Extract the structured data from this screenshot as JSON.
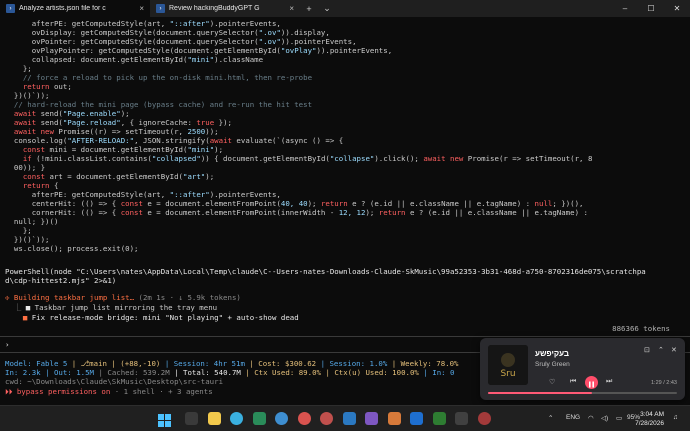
{
  "titlebar": {
    "tab1_title": "Analyze artists.json file for c",
    "tab2_title": "Review hackingBuddyGPT G",
    "close_glyph": "×",
    "add_glyph": "+",
    "dropdown_glyph": "⌄",
    "minimize_glyph": "–",
    "maximize_glyph": "☐",
    "window_close_glyph": "✕"
  },
  "code": {
    "l1a": "afterPE: getComputedStyle(art, ",
    "l1b": "\"::after\"",
    "l1c": ").pointerEvents,",
    "l2a": "ovDisplay: getComputedStyle(document.querySelector(",
    "l2b": "\".ov\"",
    "l2c": ")).display,",
    "l3a": "ovPointer: getComputedStyle(document.querySelector(",
    "l3b": "\".ov\"",
    "l3c": ")).pointerEvents,",
    "l4a": "ovPlayPointer: getComputedStyle(document.getElementById(",
    "l4b": "\"ovPlay\"",
    "l4c": ")).pointerEvents,",
    "l5a": "collapsed: document.getElementById(",
    "l5b": "\"mini\"",
    "l5c": ").className",
    "l6": "};",
    "l7": "// force a reload to pick up the on-disk mini.html, then re-probe",
    "l8a": "return",
    "l8b": " out;",
    "l9": "})()`));",
    "l10": "// hard-reload the mini page (bypass cache) and re-run the hit test",
    "l11a": "await",
    "l11b": " send(",
    "l11c": "\"Page.enable\"",
    "l11d": ");",
    "l12a": "await",
    "l12b": " send(",
    "l12c": "\"Page.reload\"",
    "l12d": ", { ignoreCache: ",
    "l12e": "true",
    "l12f": " });",
    "l13a": "await new",
    "l13b": " Promise((r) => setTimeout(r, ",
    "l13c": "2500",
    "l13d": "));",
    "l14a": "console.log(",
    "l14b": "\"AFTER-RELOAD:\"",
    "l14c": ", JSON.stringify(",
    "l14d": "await",
    "l14e": " evaluate(`(async () => {",
    "l15a": "const",
    "l15b": " mini = document.getElementById(",
    "l15c": "\"mini\"",
    "l15d": ");",
    "l16a": "if",
    "l16b": " (!mini.classList.contains(",
    "l16c": "\"collapsed\"",
    "l16d": ")) { document.getElementById(",
    "l16e": "\"collapse\"",
    "l16f": ").click(); ",
    "l16g": "await new",
    "l16h": " Promise(r => setTimeout(r, 8",
    "l17": "00)); }",
    "l18a": "const",
    "l18b": " art = document.getElementById(",
    "l18c": "\"art\"",
    "l18d": ");",
    "l19a": "return",
    "l19b": " {",
    "l20a": "afterPE: getComputedStyle(art, ",
    "l20b": "\"::after\"",
    "l20c": ").pointerEvents,",
    "l21a": "centerHit: (() => { ",
    "l21b": "const",
    "l21c": " e = document.elementFromPoint(",
    "l21d": "40, 40",
    "l21e": "); ",
    "l21f": "return",
    "l21g": " e ? (e.id || e.className || e.tagName) : ",
    "l21h": "null",
    "l21i": "; })(),",
    "l22a": "cornerHit: (() => { ",
    "l22b": "const",
    "l22c": " e = document.elementFromPoint(innerWidth - ",
    "l22d": "12, 12",
    "l22e": "); ",
    "l22f": "return",
    "l22g": " e ? (e.id || e.className || e.tagName) :",
    "l23": "null; })()",
    "l24": "};",
    "l25": "})()`));",
    "l26": "ws.close(); process.exit(0);"
  },
  "command": {
    "line1": "PowerShell(node \"C:\\Users\\nates\\AppData\\Local\\Temp\\claude\\C--Users-nates-Downloads-Claude-SkMusic\\99a52353-3b31-468d-a750-8702316de075\\scratchpa",
    "line2": "d\\cdp-hittest2.mjs\" 2>&1)"
  },
  "status": {
    "glyph": "✢",
    "building": "Building taskbar jump list…",
    "meta": "(2m 1s · ↓ 5.9k tokens)",
    "todo1_glyph": "■",
    "todo1": "Taskbar jump list mirroring the tray menu",
    "todo2_glyph": "■",
    "todo2": "Fix release-mode bridge: mini \"Not playing\" + auto-show dead",
    "tokens": "886366 tokens"
  },
  "prompt": {
    "symbol": "›"
  },
  "footer": {
    "model": "Model: Fable 5",
    "branch": "| ⎇main | (+88,-10)",
    "session_time": "| Session: 4hr 51m",
    "cost": "| Cost: $300.62",
    "session_pct": "| Session: 1.0%",
    "weekly": "| Weekly: 78.0%",
    "in_label": "In: 2.3k",
    "out_label": "| Out: 1.5M",
    "cached": "| Cached: 539.2M",
    "total": "| Total: 540.7M",
    "ctx_used": "| Ctx Used: 89.0%",
    "ctx_u_used": "| Ctx(u) Used: 100.0%",
    "in_right": "| In: 0",
    "cwd": "cwd: ~\\Downloads\\Claude\\SkMusic\\Desktop\\src-tauri",
    "bypass_glyph": "⏵⏵",
    "bypass": "bypass permissions on",
    "bypass_tail": "· 1 shell · + 3 agents"
  },
  "media": {
    "title": "בעקיפשע",
    "artist": "Sruly Green",
    "time": "1:29 / 2:43",
    "progress": 0.55,
    "art_text": "Sru"
  },
  "taskbar": {
    "lang": "ENG",
    "battery": "95%",
    "time": "3:04 AM",
    "date": "7/28/2026"
  },
  "colors": {
    "keyword": "#ff6060",
    "string": "#9cdcfe",
    "accent_orange": "#ff7043",
    "play_button": "#ff4d6a"
  }
}
